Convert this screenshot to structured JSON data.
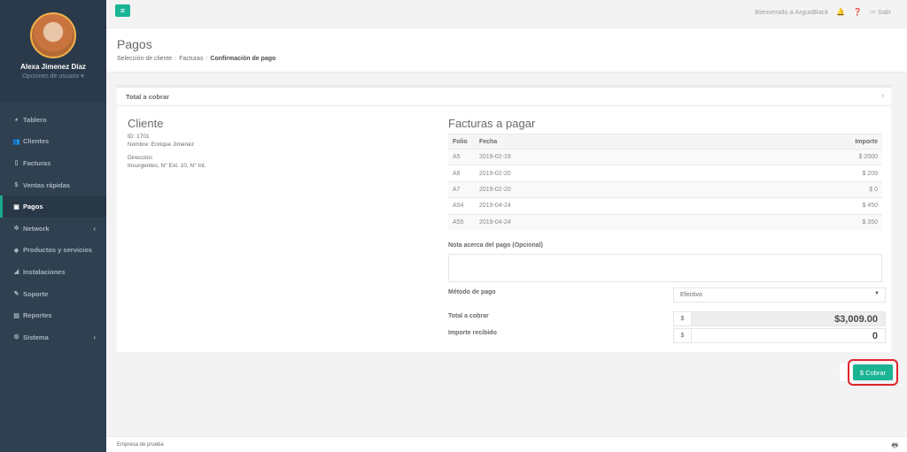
{
  "user": {
    "name": "Alexa Jimenez Díaz",
    "options": "Opciones de usuario ▾"
  },
  "sidebar": {
    "items": [
      {
        "label": "Tablero",
        "icon": "dashboard-icon"
      },
      {
        "label": "Clientes",
        "icon": "users-icon"
      },
      {
        "label": "Facturas",
        "icon": "file-icon"
      },
      {
        "label": "Ventas rápidas",
        "icon": "dollar-icon"
      },
      {
        "label": "Pagos",
        "icon": "money-icon"
      },
      {
        "label": "Network",
        "icon": "sitemap-icon"
      },
      {
        "label": "Productos y servicios",
        "icon": "tag-icon"
      },
      {
        "label": "Instalaciones",
        "icon": "wrench-icon"
      },
      {
        "label": "Soporte",
        "icon": "support-icon"
      },
      {
        "label": "Reportes",
        "icon": "reports-icon"
      },
      {
        "label": "Sistema",
        "icon": "cogs-icon"
      }
    ]
  },
  "topbar": {
    "welcome": "Bienvenido a ArgusBlack",
    "logout": "Salir"
  },
  "page": {
    "title": "Pagos",
    "breadcrumb": [
      "Selección de cliente",
      "Facturas",
      "Confirmación de pago"
    ]
  },
  "panel": {
    "title": "Total a cobrar"
  },
  "cliente": {
    "heading": "Cliente",
    "id": "ID: 1701",
    "nombre": "Nombre: Enrique Jimenez",
    "direccion_label": "Dirección:",
    "direccion": "Insurgentes, N° Ext. 10, N° Int."
  },
  "facturas": {
    "heading": "Facturas a pagar",
    "columns": [
      "Folio",
      "Fecha",
      "Importe"
    ],
    "rows": [
      {
        "folio": "A5",
        "fecha": "2019-02-19",
        "importe": "$ 2000"
      },
      {
        "folio": "A6",
        "fecha": "2019-02-20",
        "importe": "$ 209"
      },
      {
        "folio": "A7",
        "fecha": "2019-02-20",
        "importe": "$ 0"
      },
      {
        "folio": "A54",
        "fecha": "2019-04-24",
        "importe": "$ 450"
      },
      {
        "folio": "A55",
        "fecha": "2019-04-24",
        "importe": "$ 350"
      }
    ]
  },
  "form": {
    "nota_label": "Nota acerca del pago (Opcional)",
    "nota_value": "",
    "metodo_label": "Método de pago",
    "metodo_value": "Efectivo",
    "total_label": "Total a cobrar",
    "total_value": "$3,009.00",
    "recibido_label": "Importe recibido",
    "recibido_value": "0",
    "currency": "$"
  },
  "actions": {
    "cobrar": "$ Cobrar"
  },
  "footer": {
    "text": "Empresa de prueba"
  },
  "colors": {
    "accent": "#1ab394",
    "sidebar": "#2f4050",
    "highlight": "#e0242b"
  }
}
